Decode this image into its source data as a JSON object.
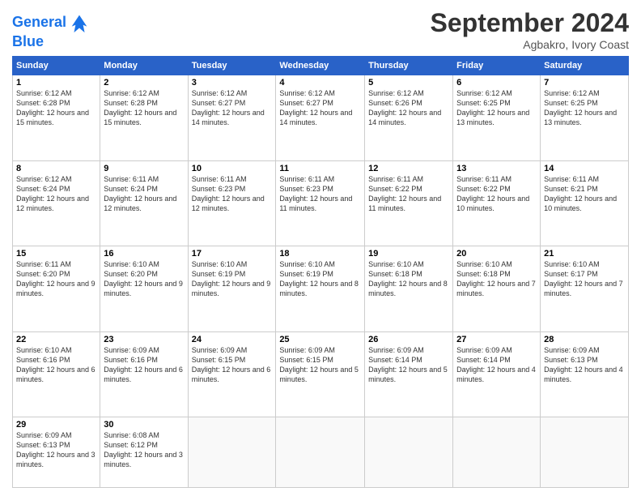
{
  "header": {
    "logo_line1": "General",
    "logo_line2": "Blue",
    "month": "September 2024",
    "location": "Agbakro, Ivory Coast"
  },
  "weekdays": [
    "Sunday",
    "Monday",
    "Tuesday",
    "Wednesday",
    "Thursday",
    "Friday",
    "Saturday"
  ],
  "weeks": [
    [
      {
        "day": "1",
        "sunrise": "6:12 AM",
        "sunset": "6:28 PM",
        "daylight": "12 hours and 15 minutes."
      },
      {
        "day": "2",
        "sunrise": "6:12 AM",
        "sunset": "6:28 PM",
        "daylight": "12 hours and 15 minutes."
      },
      {
        "day": "3",
        "sunrise": "6:12 AM",
        "sunset": "6:27 PM",
        "daylight": "12 hours and 14 minutes."
      },
      {
        "day": "4",
        "sunrise": "6:12 AM",
        "sunset": "6:27 PM",
        "daylight": "12 hours and 14 minutes."
      },
      {
        "day": "5",
        "sunrise": "6:12 AM",
        "sunset": "6:26 PM",
        "daylight": "12 hours and 14 minutes."
      },
      {
        "day": "6",
        "sunrise": "6:12 AM",
        "sunset": "6:25 PM",
        "daylight": "12 hours and 13 minutes."
      },
      {
        "day": "7",
        "sunrise": "6:12 AM",
        "sunset": "6:25 PM",
        "daylight": "12 hours and 13 minutes."
      }
    ],
    [
      {
        "day": "8",
        "sunrise": "6:12 AM",
        "sunset": "6:24 PM",
        "daylight": "12 hours and 12 minutes."
      },
      {
        "day": "9",
        "sunrise": "6:11 AM",
        "sunset": "6:24 PM",
        "daylight": "12 hours and 12 minutes."
      },
      {
        "day": "10",
        "sunrise": "6:11 AM",
        "sunset": "6:23 PM",
        "daylight": "12 hours and 12 minutes."
      },
      {
        "day": "11",
        "sunrise": "6:11 AM",
        "sunset": "6:23 PM",
        "daylight": "12 hours and 11 minutes."
      },
      {
        "day": "12",
        "sunrise": "6:11 AM",
        "sunset": "6:22 PM",
        "daylight": "12 hours and 11 minutes."
      },
      {
        "day": "13",
        "sunrise": "6:11 AM",
        "sunset": "6:22 PM",
        "daylight": "12 hours and 10 minutes."
      },
      {
        "day": "14",
        "sunrise": "6:11 AM",
        "sunset": "6:21 PM",
        "daylight": "12 hours and 10 minutes."
      }
    ],
    [
      {
        "day": "15",
        "sunrise": "6:11 AM",
        "sunset": "6:20 PM",
        "daylight": "12 hours and 9 minutes."
      },
      {
        "day": "16",
        "sunrise": "6:10 AM",
        "sunset": "6:20 PM",
        "daylight": "12 hours and 9 minutes."
      },
      {
        "day": "17",
        "sunrise": "6:10 AM",
        "sunset": "6:19 PM",
        "daylight": "12 hours and 9 minutes."
      },
      {
        "day": "18",
        "sunrise": "6:10 AM",
        "sunset": "6:19 PM",
        "daylight": "12 hours and 8 minutes."
      },
      {
        "day": "19",
        "sunrise": "6:10 AM",
        "sunset": "6:18 PM",
        "daylight": "12 hours and 8 minutes."
      },
      {
        "day": "20",
        "sunrise": "6:10 AM",
        "sunset": "6:18 PM",
        "daylight": "12 hours and 7 minutes."
      },
      {
        "day": "21",
        "sunrise": "6:10 AM",
        "sunset": "6:17 PM",
        "daylight": "12 hours and 7 minutes."
      }
    ],
    [
      {
        "day": "22",
        "sunrise": "6:10 AM",
        "sunset": "6:16 PM",
        "daylight": "12 hours and 6 minutes."
      },
      {
        "day": "23",
        "sunrise": "6:09 AM",
        "sunset": "6:16 PM",
        "daylight": "12 hours and 6 minutes."
      },
      {
        "day": "24",
        "sunrise": "6:09 AM",
        "sunset": "6:15 PM",
        "daylight": "12 hours and 6 minutes."
      },
      {
        "day": "25",
        "sunrise": "6:09 AM",
        "sunset": "6:15 PM",
        "daylight": "12 hours and 5 minutes."
      },
      {
        "day": "26",
        "sunrise": "6:09 AM",
        "sunset": "6:14 PM",
        "daylight": "12 hours and 5 minutes."
      },
      {
        "day": "27",
        "sunrise": "6:09 AM",
        "sunset": "6:14 PM",
        "daylight": "12 hours and 4 minutes."
      },
      {
        "day": "28",
        "sunrise": "6:09 AM",
        "sunset": "6:13 PM",
        "daylight": "12 hours and 4 minutes."
      }
    ],
    [
      {
        "day": "29",
        "sunrise": "6:09 AM",
        "sunset": "6:13 PM",
        "daylight": "12 hours and 3 minutes."
      },
      {
        "day": "30",
        "sunrise": "6:08 AM",
        "sunset": "6:12 PM",
        "daylight": "12 hours and 3 minutes."
      },
      null,
      null,
      null,
      null,
      null
    ]
  ]
}
